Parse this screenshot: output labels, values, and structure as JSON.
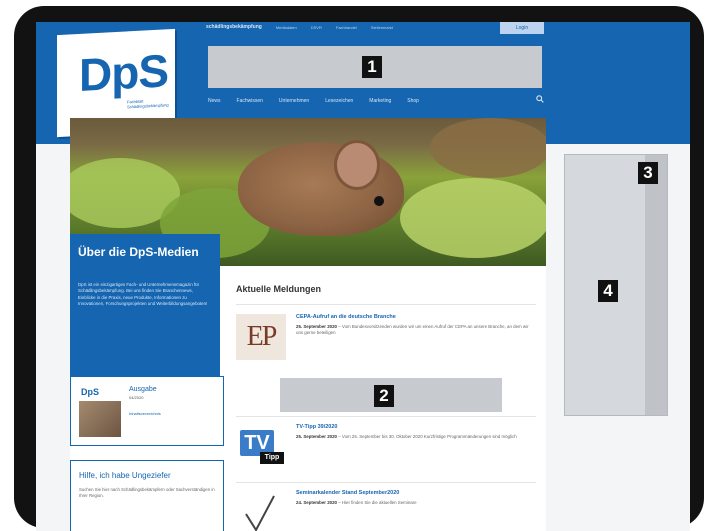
{
  "header": {
    "brand_small": "schädlingsbekämpfung",
    "top_links": [
      "Mediadaten",
      "DSVR",
      "Fachhandel",
      "Stellenmarkt"
    ],
    "login_label": "Login",
    "logo_text": "DpS",
    "logo_subtitle": "Fachblatt Schädlingsbekämpfung",
    "nav": [
      "News",
      "Fachwissen",
      "Unternehmen",
      "Lesezeichen",
      "Marketing",
      "Shop"
    ],
    "colors": {
      "brand": "#1565b0",
      "light": "#d8e6f6"
    }
  },
  "redactions": {
    "badge_1": "1",
    "badge_2": "2",
    "badge_3": "3",
    "badge_4": "4"
  },
  "about": {
    "title": "Über die DpS-Medien",
    "text": "DpS ist ein einzigartiges Fach- und Unternehmensmagazin für Schädlingsbekämpfung. Bei uns finden Sie Branchennews, Einblicke in die Praxis, neue Produkte, Informationen zu Innovationen, Forschungsprojekten und Weiterbildungsangeboten!"
  },
  "issue_box": {
    "logo": "DpS",
    "title": "Ausgabe",
    "subtitle": "04/2020",
    "link": "Inhaltsverzeichnis"
  },
  "help_box": {
    "title": "Hilfe, ich habe Ungeziefer",
    "text": "Suchen Sie hier nach Schädlingsbekämpfern oder Sachverständigen in Ihrer Region."
  },
  "news": {
    "heading": "Aktuelle Meldungen",
    "items": [
      {
        "title": "CEPA-Aufruf an die deutsche Branche",
        "date": "25. September 2020",
        "text": "Vom Bundesvorsitzenden wurden wir um einen Aufruf der CEPA an unsere Branche, an dem wir uns gerne beteiligen",
        "thumb": "EP"
      },
      {
        "title": "TV-Tipp 39/2020",
        "date": "25. September 2020",
        "text": "Vom 25. September bis 30. Oktober 2020 Kurzfristige Programmänderungen sind möglich",
        "thumb_main": "TV",
        "thumb_sub": "Tipp"
      },
      {
        "title": "Seminarkalender Stand September2020",
        "date": "24. September 2020",
        "text": "Hier finden Sie die aktuellen Seminare"
      }
    ]
  }
}
